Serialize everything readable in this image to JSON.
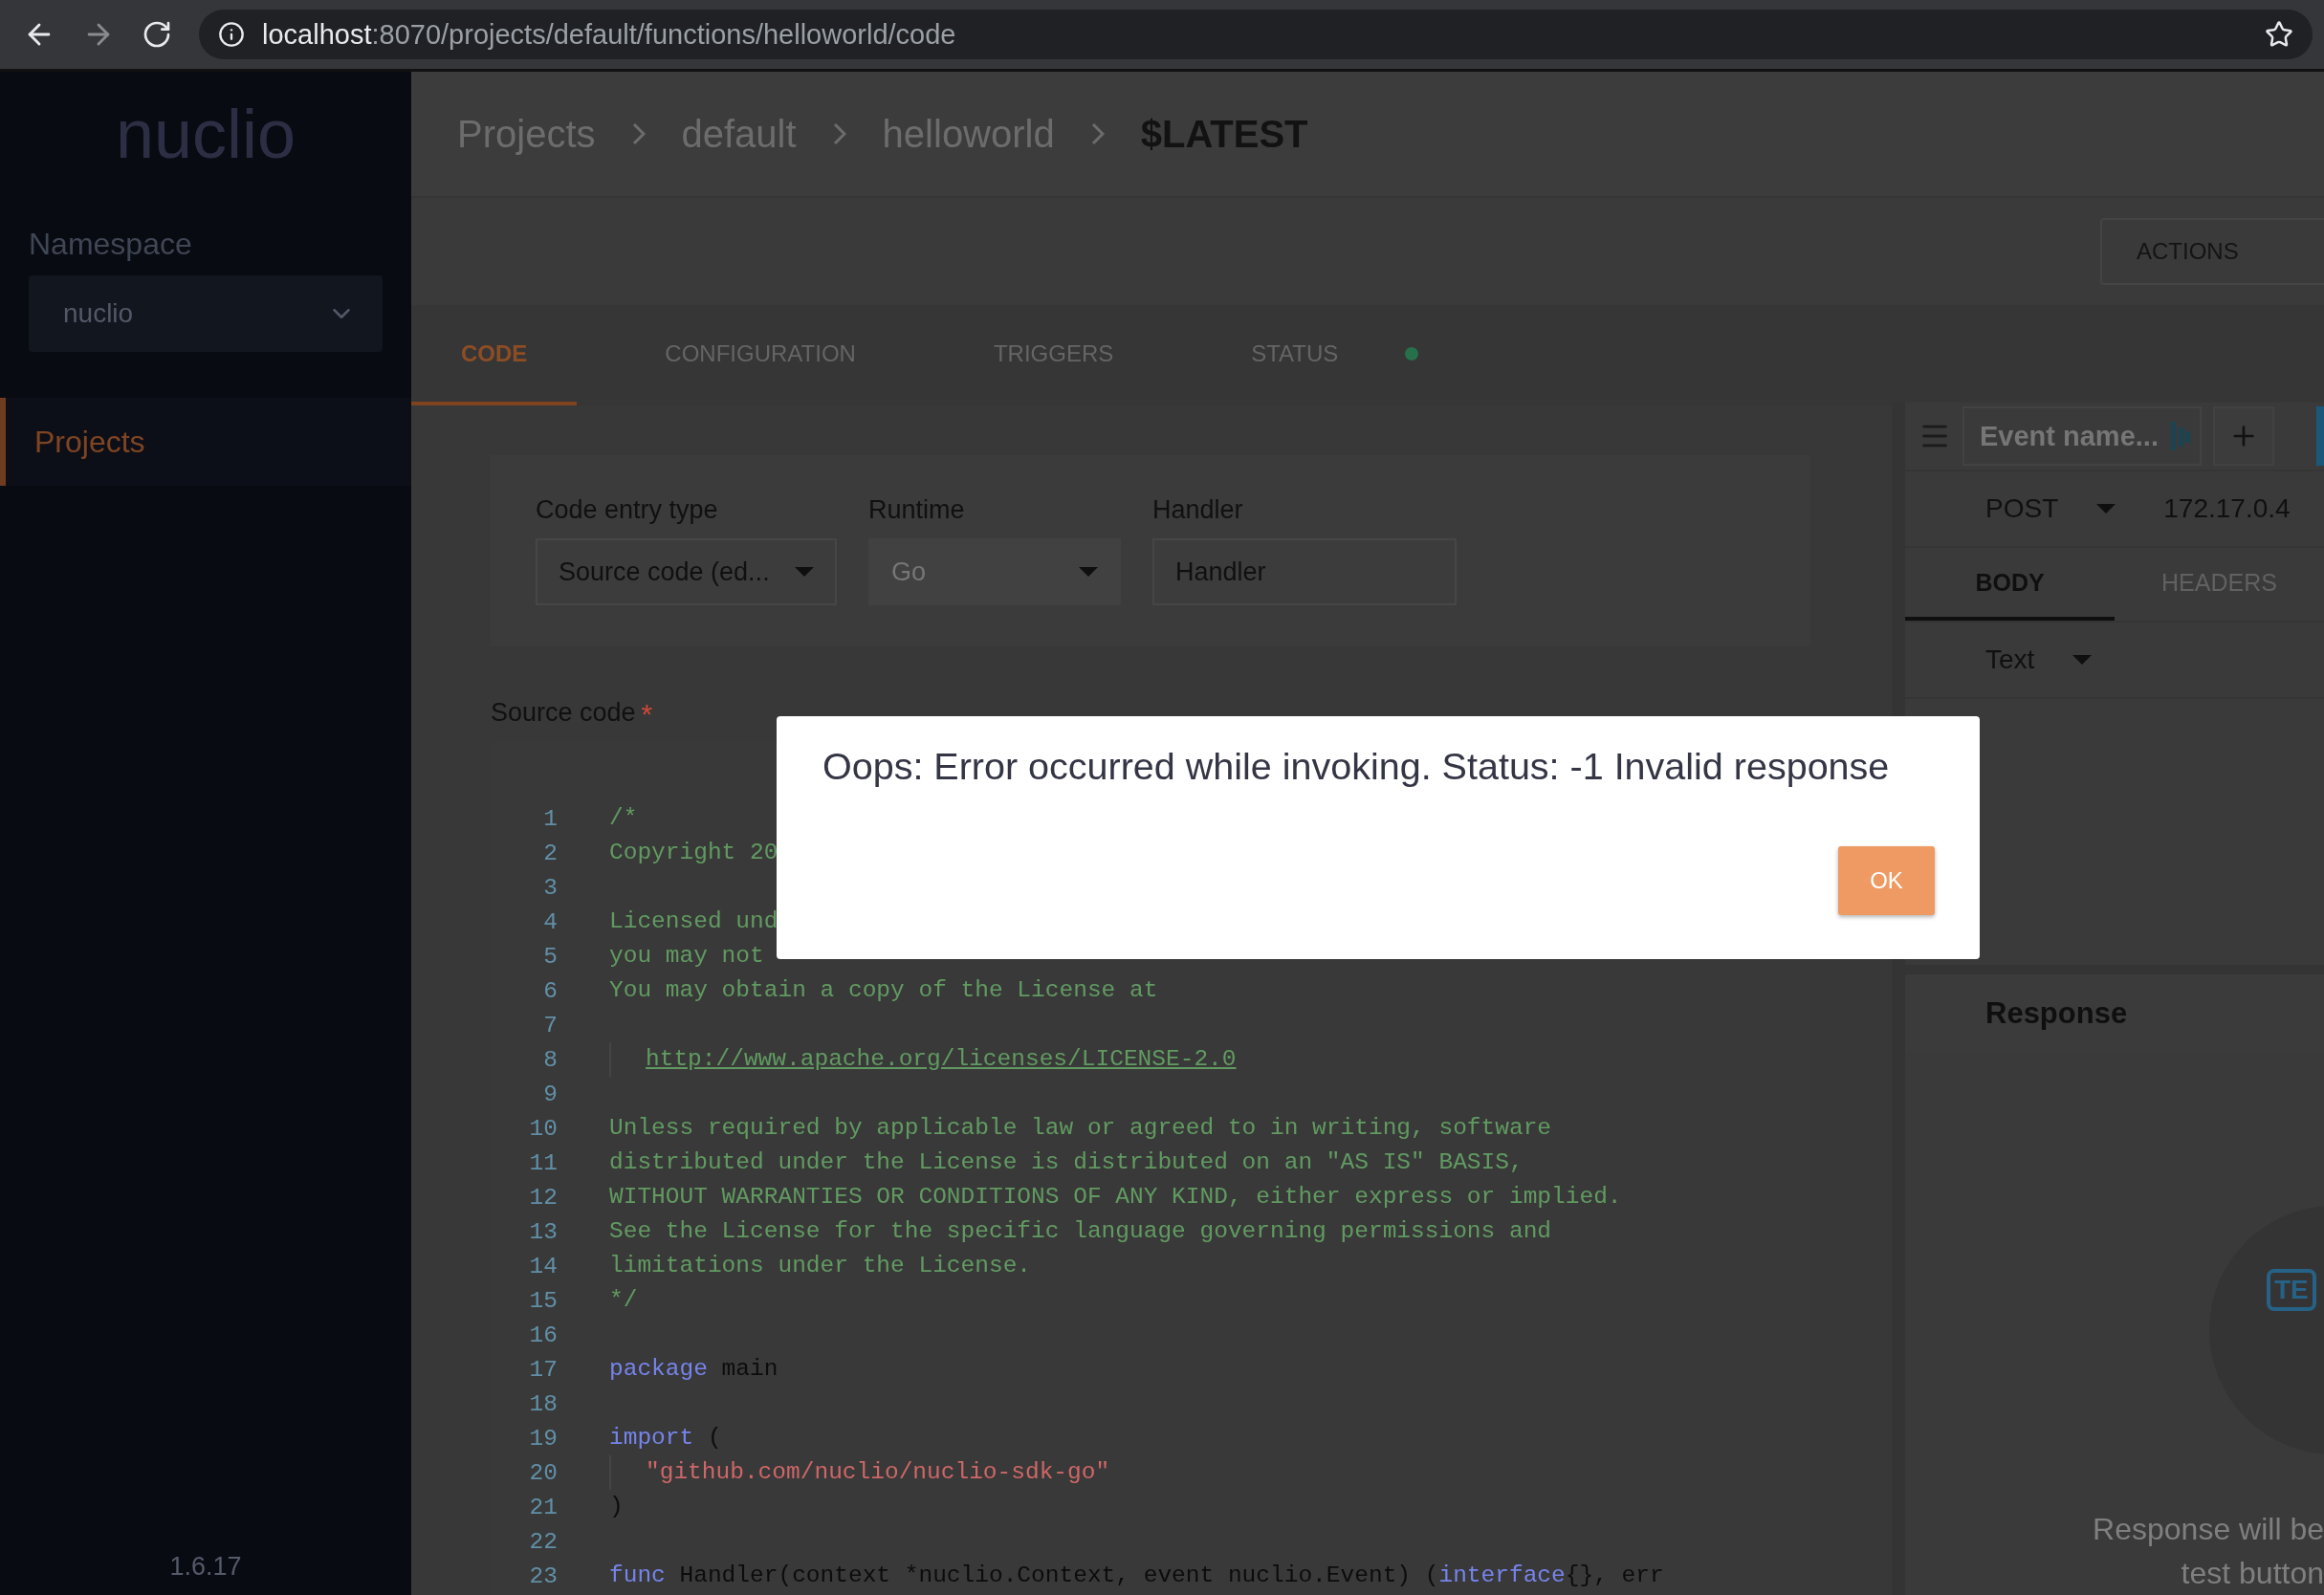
{
  "browser": {
    "url_host": "localhost",
    "url_path": ":8070/projects/default/functions/helloworld/code"
  },
  "sidebar": {
    "logo": "nuclio",
    "namespace_label": "Namespace",
    "namespace_value": "nuclio",
    "items": [
      {
        "label": "Projects",
        "selected": true
      }
    ],
    "version": "1.6.17"
  },
  "breadcrumbs": [
    {
      "label": "Projects",
      "current": false
    },
    {
      "label": "default",
      "current": false
    },
    {
      "label": "helloworld",
      "current": false
    },
    {
      "label": "$LATEST",
      "current": true
    }
  ],
  "actions_button": "ACTIONS",
  "tabs": [
    {
      "label": "CODE",
      "selected": true,
      "indicator": false
    },
    {
      "label": "CONFIGURATION",
      "selected": false,
      "indicator": false
    },
    {
      "label": "TRIGGERS",
      "selected": false,
      "indicator": false
    },
    {
      "label": "STATUS",
      "selected": false,
      "indicator": true
    }
  ],
  "form": {
    "fields": [
      {
        "label": "Code entry type",
        "value": "Source code (ed...",
        "kind": "dropdown",
        "disabled": false
      },
      {
        "label": "Runtime",
        "value": "Go",
        "kind": "dropdown",
        "disabled": true
      },
      {
        "label": "Handler",
        "value": "Handler",
        "kind": "text",
        "disabled": false
      }
    ]
  },
  "source_label": "Source code",
  "required_mark": "*",
  "code_lines": [
    {
      "number": "1",
      "segments": [
        {
          "text": "/*",
          "kind": "comment"
        }
      ]
    },
    {
      "number": "2",
      "segments": [
        {
          "text": "Copyright 20",
          "kind": "comment"
        }
      ]
    },
    {
      "number": "3"
    },
    {
      "number": "4",
      "segments": [
        {
          "text": "Licensed und",
          "kind": "comment"
        }
      ]
    },
    {
      "number": "5",
      "segments": [
        {
          "text": "you may not",
          "kind": "comment"
        }
      ]
    },
    {
      "number": "6",
      "segments": [
        {
          "text": "You may obtain a copy of the License at",
          "kind": "comment"
        }
      ]
    },
    {
      "number": "7"
    },
    {
      "number": "8",
      "indent": true,
      "segments": [
        {
          "text": "http://www.apache.org/licenses/LICENSE-2.0",
          "kind": "link"
        }
      ]
    },
    {
      "number": "9"
    },
    {
      "number": "10",
      "segments": [
        {
          "text": "Unless required by applicable law or agreed to in writing, software",
          "kind": "comment"
        }
      ]
    },
    {
      "number": "11",
      "segments": [
        {
          "text": "distributed under the License is distributed on an \"AS IS\" BASIS,",
          "kind": "comment"
        }
      ]
    },
    {
      "number": "12",
      "segments": [
        {
          "text": "WITHOUT WARRANTIES OR CONDITIONS OF ANY KIND, either express or implied.",
          "kind": "comment"
        }
      ]
    },
    {
      "number": "13",
      "segments": [
        {
          "text": "See the License for the specific language governing permissions and",
          "kind": "comment"
        }
      ]
    },
    {
      "number": "14",
      "segments": [
        {
          "text": "limitations under the License.",
          "kind": "comment"
        }
      ]
    },
    {
      "number": "15",
      "segments": [
        {
          "text": "*/",
          "kind": "comment"
        }
      ]
    },
    {
      "number": "16"
    },
    {
      "number": "17",
      "segments": [
        {
          "text": "package",
          "kind": "keyword"
        },
        {
          "text": " main",
          "kind": "plain"
        }
      ]
    },
    {
      "number": "18"
    },
    {
      "number": "19",
      "segments": [
        {
          "text": "import",
          "kind": "keyword"
        },
        {
          "text": " (",
          "kind": "plain"
        }
      ]
    },
    {
      "number": "20",
      "indent": true,
      "segments": [
        {
          "text": "\"github.com/nuclio/nuclio-sdk-go\"",
          "kind": "string"
        }
      ]
    },
    {
      "number": "21",
      "segments": [
        {
          "text": ")",
          "kind": "plain"
        }
      ]
    },
    {
      "number": "22"
    },
    {
      "number": "23",
      "segments": [
        {
          "text": "func",
          "kind": "keyword"
        },
        {
          "text": " Handler(context *nuclio.Context, event nuclio.Event) (",
          "kind": "plain"
        },
        {
          "text": "interface",
          "kind": "keyword"
        },
        {
          "text": "{}, err",
          "kind": "plain"
        }
      ]
    }
  ],
  "test_panel": {
    "event_placeholder": "Event name...",
    "method": "POST",
    "address": "172.17.0.4",
    "tabs": [
      {
        "label": "BODY",
        "selected": true
      },
      {
        "label": "HEADERS",
        "selected": false
      }
    ],
    "body_type": "Text",
    "response_title": "Response",
    "illustration_label": "TE",
    "empty_lines": [
      "Response will be",
      "test button"
    ]
  },
  "dialog": {
    "message": "Oops: Error occurred while invoking. Status: -1 Invalid response",
    "button": "OK"
  }
}
